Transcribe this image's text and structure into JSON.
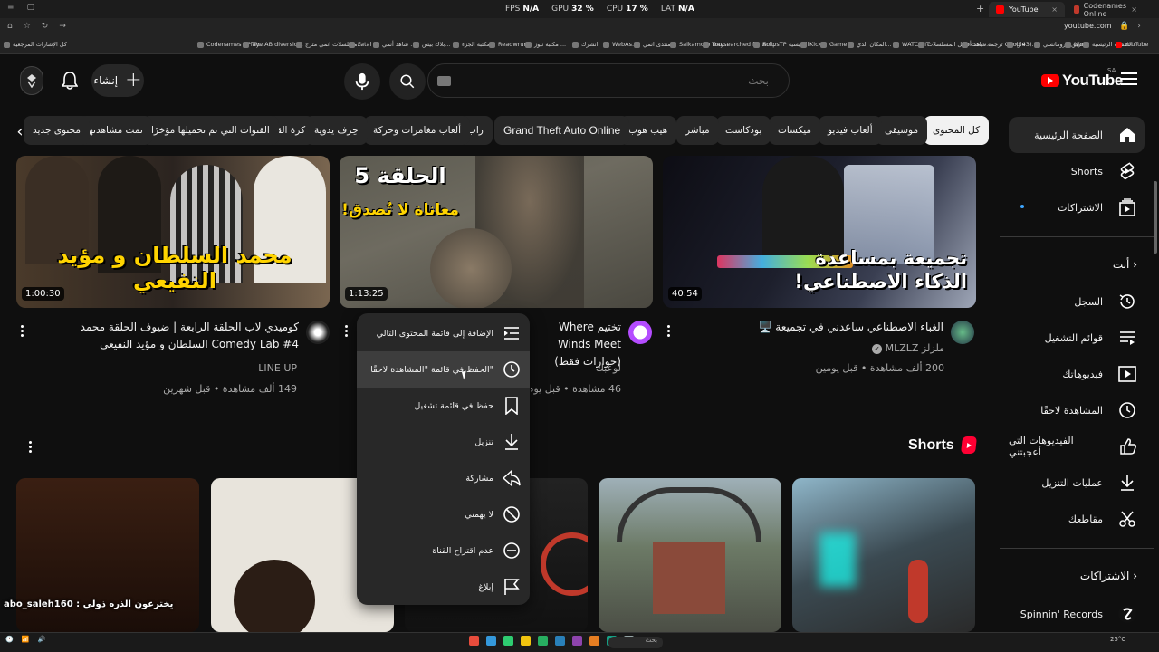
{
  "titlebar": {
    "perf": [
      {
        "label": "FPS",
        "value": "N/A"
      },
      {
        "label": "GPU",
        "value": "32 %"
      },
      {
        "label": "CPU",
        "value": "17 %"
      },
      {
        "label": "LAT",
        "value": "N/A"
      }
    ],
    "tabs": [
      {
        "title": "YouTube",
        "active": true
      },
      {
        "title": "Codenames Online",
        "active": false
      }
    ]
  },
  "browser": {
    "url": "youtube.com",
    "bookmarks": [
      "كل الإشارات المرجعية",
      "Codenames - Play...",
      "The AB diversio...",
      "مسلسلات انمي مترج...",
      "Fatal ▸",
      "شاهد أنمي ...",
      "بلاك بيس...",
      "مكتبة الجزء...",
      "Readwrung",
      "مكتبة نيوز ...",
      "انشرك",
      "WebAs...",
      "منتدى انمي...",
      "Saikamoto Day...",
      "You searched for Ao...",
      "EclipsTP الرئيسية",
      "Kick",
      "Game...",
      "المكان الذي...",
      "WATCH IT",
      "شاهد أفضل المسلسلات...",
      "ترجمة - بحث Google",
      "(143)...",
      "فريق الرومانسي",
      "Nin...",
      "الصفحة الرئيسية",
      "YouTube"
    ]
  },
  "header": {
    "logo_text": "YouTube",
    "region": "SA",
    "search_placeholder": "بحث",
    "create_label": "إنشاء"
  },
  "chips": [
    {
      "label": "كل المحتوى",
      "active": true
    },
    {
      "label": "موسيقى"
    },
    {
      "label": "ألعاب فيديو"
    },
    {
      "label": "ميكسات"
    },
    {
      "label": "بودكاست"
    },
    {
      "label": "مباشر"
    },
    {
      "label": "هيب هوب"
    },
    {
      "label": "Grand Theft Auto Online"
    },
    {
      "label": "راب"
    },
    {
      "label": "ألعاب مغامرات وحركة"
    },
    {
      "label": "حِرف يدوية"
    },
    {
      "label": "كرة القدم"
    },
    {
      "label": "القنوات التي تم تحميلها مؤخرًا"
    },
    {
      "label": "تمت مشاهدتها"
    },
    {
      "label": "محتوى جديد"
    }
  ],
  "sidebar": {
    "home": "الصفحة الرئيسية",
    "shorts": "Shorts",
    "subscriptions": "الاشتراكات",
    "you_header": "أنت",
    "history": "السجل",
    "playlists": "قوائم التشغيل",
    "your_videos": "فيديوهاتك",
    "watch_later": "المشاهدة لاحقًا",
    "liked_videos": "الفيديوهات التي أعجبتني",
    "downloads": "عمليات التنزيل",
    "clips": "مقاطعك",
    "subs_header": "الاشتراكات",
    "sub_channel": "Spinnin' Records"
  },
  "videos": [
    {
      "title": "الغباء الاصطناعي ساعدني في تجميعة 🖥️",
      "channel": "ملزلز MLZLZ",
      "meta": "200 ألف مشاهدة • قبل يومين",
      "duration": "40:54",
      "thumb_text": "تجميعة بمساعدة الذكاء الاصطناعي!"
    },
    {
      "title": "تختيم Where Winds Meet (حوارات فقط)",
      "channel": "لوعبك",
      "meta": "46 مشاهدة • قبل يوم واحد",
      "duration": "1:13:25",
      "thumb_text_1": "الحلقة 5",
      "thumb_text_2": "معاناة لا تُصدق!"
    },
    {
      "title": "كوميدي لاب الحلقة الرابعة | ضيوف الحلقة محمد Comedy Lab #4 السلطان و مؤيد النفيعي",
      "channel": "LINE UP",
      "meta": "149 ألف مشاهدة • قبل شهرين",
      "duration": "1:00:30",
      "thumb_text": "محمد السلطان و مؤيد النفيعي"
    }
  ],
  "shorts": {
    "title": "Shorts"
  },
  "menu": {
    "items": [
      {
        "label": "الإضافة إلى قائمة المحتوى التالي",
        "icon": "queue-icon"
      },
      {
        "label": "الحفظ في قائمة \"المشاهدة لاحقًا\"",
        "icon": "clock-icon",
        "hover": true
      },
      {
        "label": "حفظ في قائمة تشغيل",
        "icon": "bookmark-icon"
      },
      {
        "label": "تنزيل",
        "icon": "download-icon"
      },
      {
        "label": "مشاركة",
        "icon": "share-icon"
      },
      {
        "label": "لا يهمني",
        "icon": "not-interested-icon"
      },
      {
        "label": "عدم اقتراح القناة",
        "icon": "minus-circle-icon"
      },
      {
        "label": "إبلاغ",
        "icon": "flag-icon"
      }
    ]
  },
  "overlay": {
    "streamer_text": "يخترعون الذره ذولي : abo_saleh160"
  },
  "taskbar": {
    "search_label": "بحث",
    "clock": "25°C"
  },
  "colors": {
    "accent": "#ff0000",
    "background": "#0f0f0f",
    "chip": "#272727",
    "menu": "#282828"
  }
}
